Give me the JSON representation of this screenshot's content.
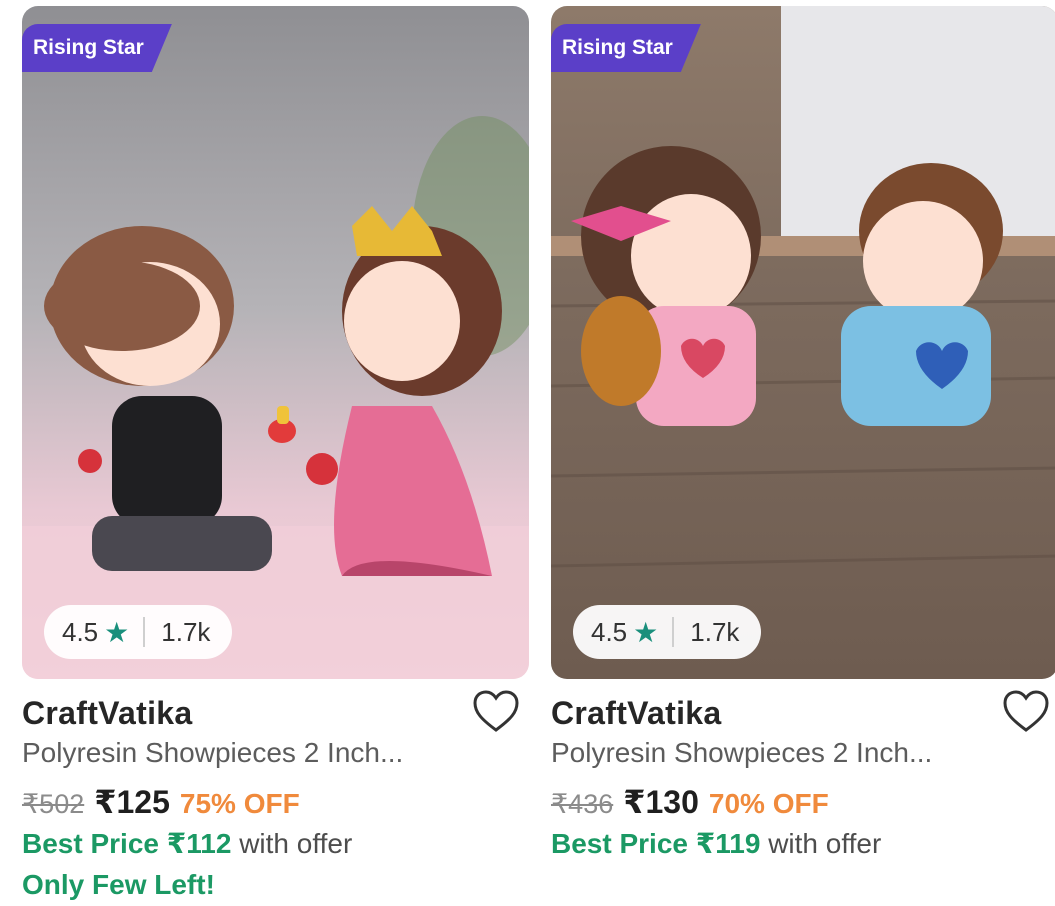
{
  "products": [
    {
      "badge": "Rising Star",
      "image_icon": "couple-figurine-proposal-image",
      "rating": "4.5",
      "rating_star": "★",
      "reviews": "1.7k",
      "brand": "CraftVatika",
      "description": "Polyresin Showpieces 2 Inch...",
      "mrp": "₹502",
      "price": "₹125",
      "discount": "75% OFF",
      "best_price": "Best Price ₹112",
      "best_suffix": "with offer",
      "stock_note": "Only Few Left!"
    },
    {
      "badge": "Rising Star",
      "image_icon": "couple-figurine-kissing-image",
      "rating": "4.5",
      "rating_star": "★",
      "reviews": "1.7k",
      "brand": "CraftVatika",
      "description": "Polyresin Showpieces 2 Inch...",
      "mrp": "₹436",
      "price": "₹130",
      "discount": "70% OFF",
      "best_price": "Best Price ₹119",
      "best_suffix": "with offer"
    }
  ],
  "colors": {
    "badge": "#5b3fc8",
    "star": "#1a8f7c",
    "discount": "#f08a3c",
    "best_price": "#1b9964"
  }
}
